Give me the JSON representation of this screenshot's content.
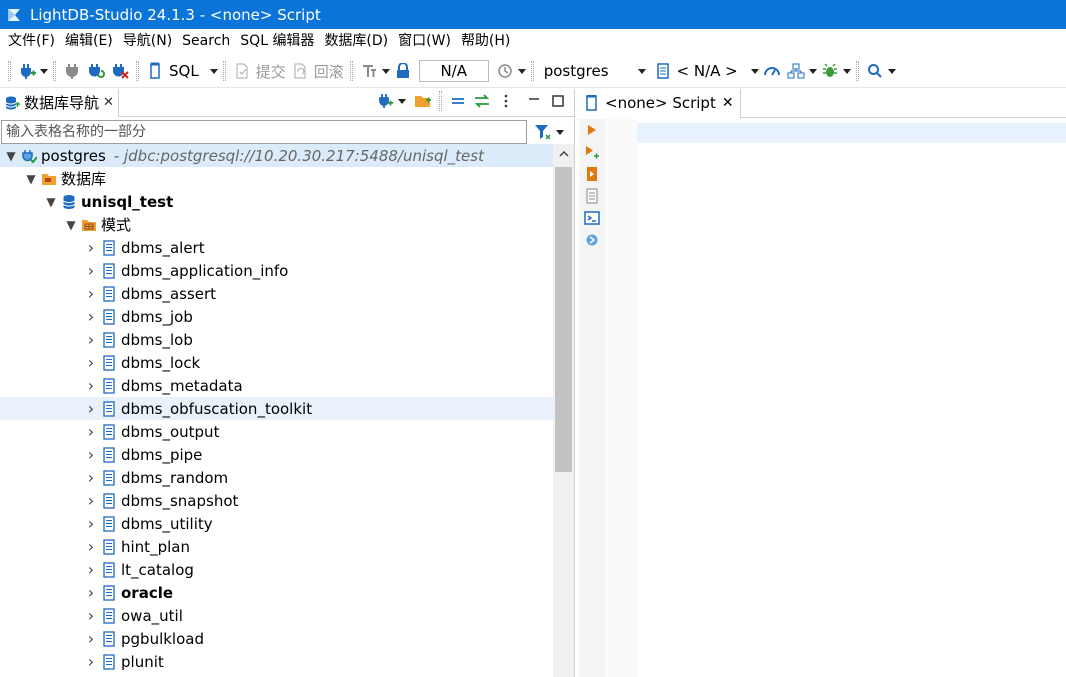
{
  "window": {
    "title": "LightDB-Studio 24.1.3 - <none> Script"
  },
  "menubar": [
    {
      "label": "文件(F)"
    },
    {
      "label": "编辑(E)"
    },
    {
      "label": "导航(N)"
    },
    {
      "label": "Search"
    },
    {
      "label": "SQL 编辑器"
    },
    {
      "label": "数据库(D)"
    },
    {
      "label": "窗口(W)"
    },
    {
      "label": "帮助(H)"
    }
  ],
  "toolbar": {
    "sql_label": "SQL",
    "commit_label": "提交",
    "rollback_label": "回滚",
    "transaction_mode": "N/A",
    "datasource": "postgres",
    "schema": "< N/A >"
  },
  "navigator": {
    "tab_label": "数据库导航",
    "filter_placeholder": "输入表格名称的一部分",
    "connection": {
      "name": "postgres",
      "url": "- jdbc:postgresql://10.20.30.217:5488/unisql_test"
    },
    "databases_label": "数据库",
    "database": "unisql_test",
    "schemas_label": "模式",
    "schemas": [
      {
        "name": "dbms_alert"
      },
      {
        "name": "dbms_application_info"
      },
      {
        "name": "dbms_assert"
      },
      {
        "name": "dbms_job"
      },
      {
        "name": "dbms_lob"
      },
      {
        "name": "dbms_lock"
      },
      {
        "name": "dbms_metadata"
      },
      {
        "name": "dbms_obfuscation_toolkit"
      },
      {
        "name": "dbms_output"
      },
      {
        "name": "dbms_pipe"
      },
      {
        "name": "dbms_random"
      },
      {
        "name": "dbms_snapshot"
      },
      {
        "name": "dbms_utility"
      },
      {
        "name": "hint_plan"
      },
      {
        "name": "lt_catalog"
      },
      {
        "name": "oracle"
      },
      {
        "name": "owa_util"
      },
      {
        "name": "pgbulkload"
      },
      {
        "name": "plunit"
      }
    ]
  },
  "editor": {
    "tab_label": "<none> Script"
  },
  "colors": {
    "titlebar": "#0a74d8",
    "selected_row": "#dcebfa",
    "hover_row": "#e9f2fb",
    "current_line": "#e8f2fe"
  }
}
